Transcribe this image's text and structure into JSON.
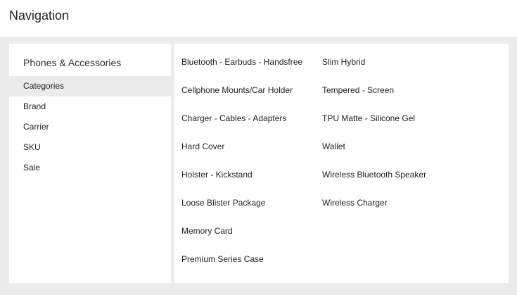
{
  "header": {
    "title": "Navigation"
  },
  "menu": {
    "heading": "Phones & Accessories",
    "items": [
      {
        "label": "Categories",
        "active": true
      },
      {
        "label": "Brand",
        "active": false
      },
      {
        "label": "Carrier",
        "active": false
      },
      {
        "label": "SKU",
        "active": false
      },
      {
        "label": "Sale",
        "active": false
      }
    ]
  },
  "categories": {
    "column1": [
      "Bluetooth - Earbuds - Handsfree",
      "Cellphone Mounts/Car Holder",
      "Charger - Cables - Adapters",
      "Hard Cover",
      "Holster - Kickstand",
      "Loose Blister Package",
      "Memory Card",
      "Premium Series Case"
    ],
    "column2": [
      "Slim Hybrid",
      "Tempered - Screen",
      "TPU Matte - Silicone Gel",
      "Wallet",
      "Wireless Bluetooth Speaker",
      "Wireless Charger"
    ]
  },
  "colors": {
    "background_gray": "#ececec",
    "panel": "#ffffff",
    "text": "#222222"
  }
}
